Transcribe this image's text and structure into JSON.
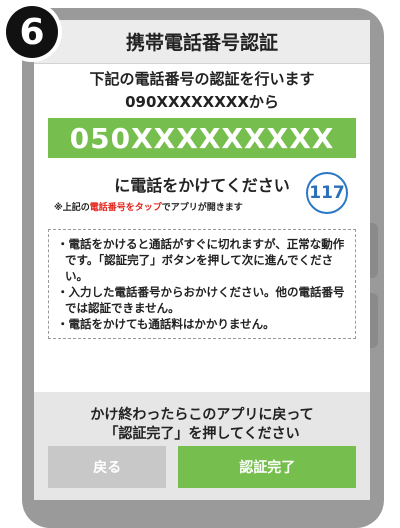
{
  "step_number": "6",
  "header": {
    "title": "携帯電話番号認証"
  },
  "info": {
    "line1": "下記の電話番号の認証を行います",
    "line2": "090XXXXXXXXから"
  },
  "call_number": "050XXXXXXXXX",
  "call_prompt": "に電話をかけてください",
  "badge": "117",
  "note": {
    "prefix": "※上記の",
    "highlight": "電話番号をタップ",
    "suffix": "でアプリが開きます"
  },
  "notices": [
    "・電話をかけると通話がすぐに切れますが、正常な動作です。「認証完了」ボタンを押して次に進んでください。",
    "・入力した電話番号からおかけください。他の電話番号では認証できません。",
    "・電話をかけても通話料はかかりません。"
  ],
  "footer": {
    "line1": "かけ終わったらこのアプリに戻って",
    "line2": "「認証完了」を押してください"
  },
  "buttons": {
    "back": "戻る",
    "confirm": "認証完了"
  },
  "colors": {
    "accent_green": "#76bf4e",
    "note_red": "#e2231a",
    "badge_blue": "#2a78c6"
  }
}
